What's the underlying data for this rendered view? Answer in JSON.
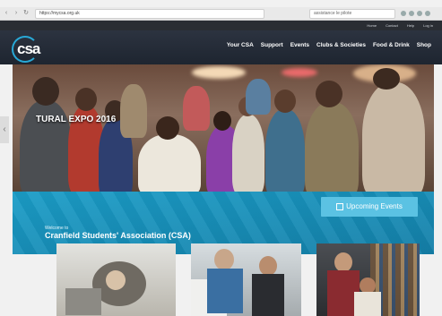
{
  "browser": {
    "url": "https://mycsa.org.uk",
    "search_placeholder": "assistance le pilote"
  },
  "top_strip": {
    "items": [
      "Home",
      "Contact",
      "Help",
      "Log in"
    ]
  },
  "header": {
    "logo_text": "csa",
    "nav": [
      "Your CSA",
      "Support",
      "Events",
      "Clubs & Societies",
      "Food & Drink",
      "Shop"
    ]
  },
  "hero": {
    "caption": "TURAL EXPO 2016"
  },
  "band": {
    "welcome_small": "Welcome to",
    "welcome_title": "Cranfield Students' Association (CSA)",
    "events_button": "Upcoming Events"
  },
  "colors": {
    "brand": "#1b9dc7",
    "header_bg": "#2c3340",
    "button": "#5bc2e3"
  }
}
